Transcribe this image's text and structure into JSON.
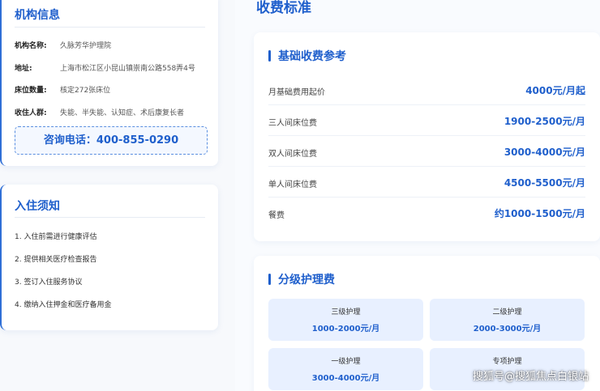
{
  "info": {
    "title": "机构信息",
    "rows": [
      {
        "label": "机构名称:",
        "value": "久脉芳华护理院"
      },
      {
        "label": "地址:",
        "value": "上海市松江区小昆山镇崇南公路558弄4号"
      },
      {
        "label": "床位数量:",
        "value": "核定272张床位"
      },
      {
        "label": "收住人群:",
        "value": "失能、半失能、认知症、术后康复长者"
      }
    ],
    "phone": "咨询电话：400-855-0290"
  },
  "notice": {
    "title": "入住须知",
    "items": [
      "1. 入住前需进行健康评估",
      "2. 提供相关医疗检查报告",
      "3. 签订入住服务协议",
      "4. 缴纳入住押金和医疗备用金"
    ]
  },
  "page_title": "收费标准",
  "fees": {
    "title": "基础收费参考",
    "rows": [
      {
        "name": "月基础费用起价",
        "price": "4000元/月起"
      },
      {
        "name": "三人间床位费",
        "price": "1900-2500元/月"
      },
      {
        "name": "双人间床位费",
        "price": "3000-4000元/月"
      },
      {
        "name": "单人间床位费",
        "price": "4500-5500元/月"
      },
      {
        "name": "餐费",
        "price": "约1000-1500元/月"
      }
    ]
  },
  "grades": {
    "title": "分级护理费",
    "items": [
      {
        "name": "三级护理",
        "price": "1000-2000元/月"
      },
      {
        "name": "二级护理",
        "price": "2000-3000元/月"
      },
      {
        "name": "一级护理",
        "price": "3000-4000元/月"
      },
      {
        "name": "专项护理",
        "price": ""
      }
    ]
  },
  "watermark": "搜狐号@搜狐焦点白银站",
  "colors": {
    "accent": "#1f5fcc",
    "background": "#f3f6fb"
  }
}
